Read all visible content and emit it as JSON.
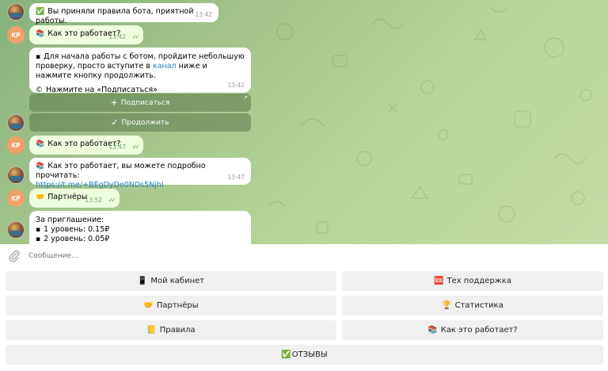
{
  "messages": {
    "m1": {
      "icon": "✅",
      "text": "Вы приняли правила бота, приятной работы.",
      "time": "13:42"
    },
    "m2": {
      "avatar": "KP",
      "icon": "📚",
      "text": "Как это работает?",
      "time": "13:42"
    },
    "m3": {
      "icon": "▪",
      "text_before": "Для начала работы с ботом, пройдите небольшую проверку, просто вступите в ",
      "link": "канал",
      "text_after": " ниже и нажмите кнопку продолжить.",
      "note_icon": "©",
      "note": "Нажмите на «Подписаться»",
      "time": "13:42",
      "buttons": {
        "subscribe_icon": "+",
        "subscribe": "Подписаться",
        "corner": "↗",
        "continue_icon": "✓",
        "continue": "Продолжить"
      }
    },
    "m4": {
      "avatar": "KP",
      "icon": "📚",
      "text": "Как это работает?",
      "time": "13:47"
    },
    "m5": {
      "icon": "📚",
      "text": "Как это работает, вы можете подробно прочитать:",
      "link": "https://t.me/+BEgDyDe0NDs5NjhI",
      "time": "13:47"
    },
    "m6": {
      "avatar": "KP",
      "icon": "🤝",
      "text": "Партнёры",
      "time": "13:52"
    },
    "m7": {
      "line1": "За приглашение:",
      "bullet": "▪",
      "level1": "1 уровень: 0.15₽",
      "level2": "2 уровень: 0.05₽"
    }
  },
  "composer": {
    "placeholder": "Сообщение..."
  },
  "keyboard": {
    "cabinet": {
      "icon": "📱",
      "label": "Мой кабинет"
    },
    "support": {
      "icon": "🆘",
      "label": "Тех поддержка"
    },
    "partners": {
      "icon": "🤝",
      "label": "Партнёры"
    },
    "stats": {
      "icon": "🏆",
      "label": "Статистика"
    },
    "rules": {
      "icon": "📒",
      "label": "Правила"
    },
    "how": {
      "icon": "📚",
      "label": "Как это работает?"
    },
    "reviews": {
      "icon": "✅",
      "label": "ОТЗЫВЫ"
    }
  },
  "colors": {
    "bubble_in": "#ffffff",
    "bubble_out": "#eeffde",
    "link": "#2a80c6",
    "check": "#4fae4e",
    "user_avatar": "#f2a06a"
  }
}
